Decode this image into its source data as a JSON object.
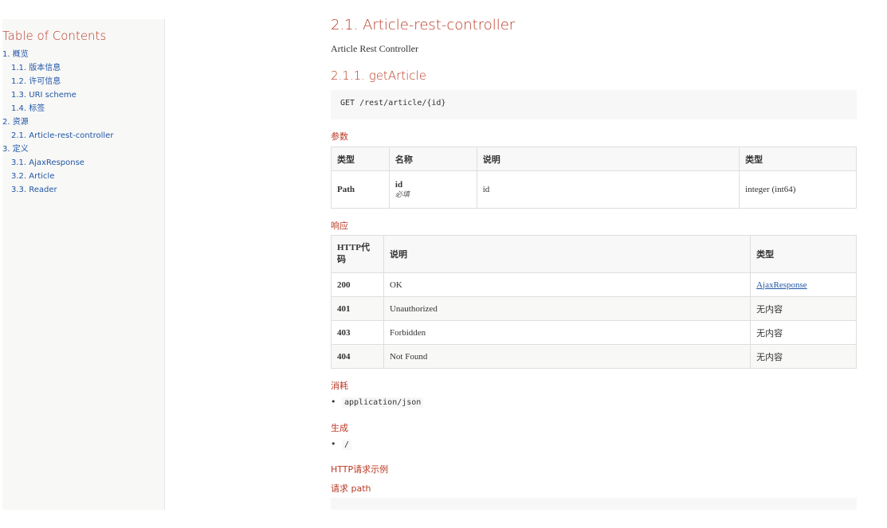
{
  "toc": {
    "title": "Table of Contents",
    "items": [
      {
        "label": "1. 概览",
        "level": 1
      },
      {
        "label": "1.1. 版本信息",
        "level": 2
      },
      {
        "label": "1.2. 许可信息",
        "level": 2
      },
      {
        "label": "1.3. URI scheme",
        "level": 2
      },
      {
        "label": "1.4. 标签",
        "level": 2
      },
      {
        "label": "2. 资源",
        "level": 1
      },
      {
        "label": "2.1. Article-rest-controller",
        "level": 2
      },
      {
        "label": "3. 定义",
        "level": 1
      },
      {
        "label": "3.1. AjaxResponse",
        "level": 2
      },
      {
        "label": "3.2. Article",
        "level": 2
      },
      {
        "label": "3.3. Reader",
        "level": 2
      }
    ]
  },
  "main": {
    "section_title": "2.1. Article-rest-controller",
    "section_desc": "Article Rest Controller",
    "op_title": "2.1.1. getArticle",
    "endpoint": "GET /rest/article/{id}",
    "params_heading": "参数",
    "params_table": {
      "headers": [
        "类型",
        "名称",
        "说明",
        "类型"
      ],
      "rows": [
        {
          "type": "Path",
          "name": "id",
          "required": "必填",
          "desc": "id",
          "schema": "integer (int64)"
        }
      ]
    },
    "responses_heading": "响应",
    "responses_table": {
      "headers": [
        "HTTP代码",
        "说明",
        "类型"
      ],
      "rows": [
        {
          "code": "200",
          "desc": "OK",
          "schema": "AjaxResponse",
          "is_link": true
        },
        {
          "code": "401",
          "desc": "Unauthorized",
          "schema": "无内容",
          "is_link": false
        },
        {
          "code": "403",
          "desc": "Forbidden",
          "schema": "无内容",
          "is_link": false
        },
        {
          "code": "404",
          "desc": "Not Found",
          "schema": "无内容",
          "is_link": false
        }
      ]
    },
    "consumes_heading": "消耗",
    "consumes": [
      "application/json"
    ],
    "produces_heading": "生成",
    "produces": [
      "/"
    ],
    "http_example_heading": "HTTP请求示例",
    "request_path_heading": "请求 path"
  },
  "colors": {
    "heading": "#ba3925",
    "link": "#2156a5",
    "code_bg": "#f7f7f8"
  }
}
